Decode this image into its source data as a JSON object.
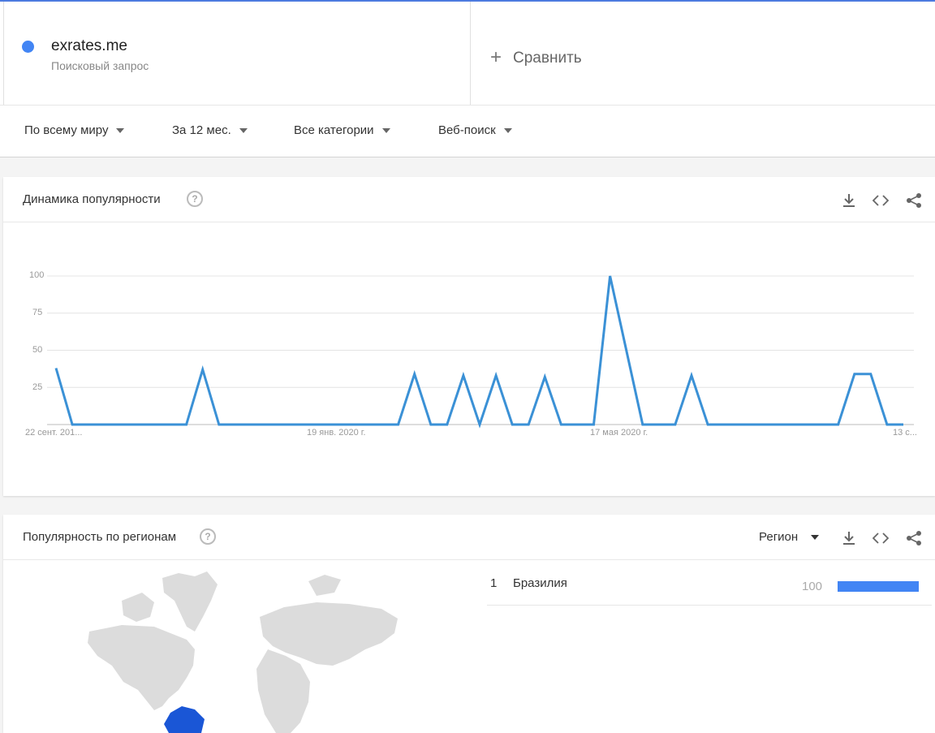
{
  "term": {
    "name": "exrates.me",
    "type": "Поисковый запрос",
    "color": "#4285f4"
  },
  "compare": {
    "label": "Сравнить"
  },
  "filters": {
    "region": "По всему миру",
    "period": "За 12 мес.",
    "category": "Все категории",
    "search_type": "Веб-поиск"
  },
  "trend_card": {
    "title": "Динамика популярности",
    "help": "?"
  },
  "region_card": {
    "title": "Популярность по регионам",
    "help": "?",
    "selector_label": "Регион"
  },
  "regions": [
    {
      "rank": "1",
      "name": "Бразилия",
      "value": "100",
      "bar_fraction": 1.0,
      "color": "#4285f4"
    }
  ],
  "chart_data": {
    "type": "line",
    "yticks": [
      "100",
      "75",
      "50",
      "25"
    ],
    "ylim": [
      0,
      100
    ],
    "grid": true,
    "xticks": [
      {
        "label": "22 сент. 201...",
        "index": 0
      },
      {
        "label": "19 янв. 2020 г.",
        "index": 17
      },
      {
        "label": "17 мая 2020 г.",
        "index": 34
      },
      {
        "label": "13 с...",
        "index": 51
      }
    ],
    "series": [
      {
        "color": "#3b91d6",
        "values": [
          38,
          0,
          0,
          0,
          0,
          0,
          0,
          0,
          0,
          37,
          0,
          0,
          0,
          0,
          0,
          0,
          0,
          0,
          0,
          0,
          0,
          0,
          34,
          0,
          0,
          33,
          0,
          33,
          0,
          0,
          32,
          0,
          0,
          0,
          100,
          50,
          0,
          0,
          0,
          33,
          0,
          0,
          0,
          0,
          0,
          0,
          0,
          0,
          0,
          34,
          34,
          0,
          0
        ]
      }
    ]
  }
}
